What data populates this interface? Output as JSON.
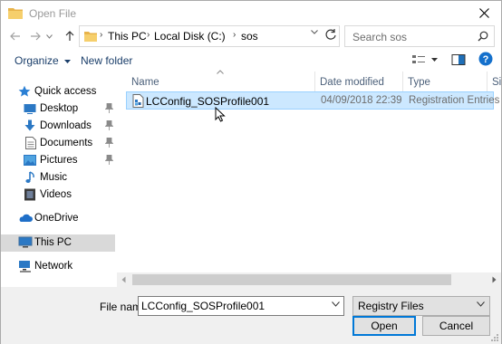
{
  "title": "Open File",
  "address": {
    "crumbs": [
      "This PC",
      "Local Disk (C:)",
      "sos"
    ]
  },
  "search": {
    "placeholder": "Search sos"
  },
  "toolbar": {
    "organize": "Organize",
    "new_folder": "New folder"
  },
  "nav": {
    "quick_access": "Quick access",
    "desktop": "Desktop",
    "downloads": "Downloads",
    "documents": "Documents",
    "pictures": "Pictures",
    "music": "Music",
    "videos": "Videos",
    "onedrive": "OneDrive",
    "this_pc": "This PC",
    "network": "Network"
  },
  "columns": {
    "name": "Name",
    "date": "Date modified",
    "type": "Type",
    "size": "Si"
  },
  "files": [
    {
      "name": "LCConfig_SOSProfile001",
      "date": "04/09/2018 22:39",
      "type": "Registration Entries"
    }
  ],
  "bottom": {
    "file_name_label": "File name:",
    "file_name_value": "LCConfig_SOSProfile001",
    "filter": "Registry Files",
    "open": "Open",
    "cancel": "Cancel"
  },
  "colors": {
    "selection": "#cce8ff",
    "accent": "#0078d7"
  }
}
